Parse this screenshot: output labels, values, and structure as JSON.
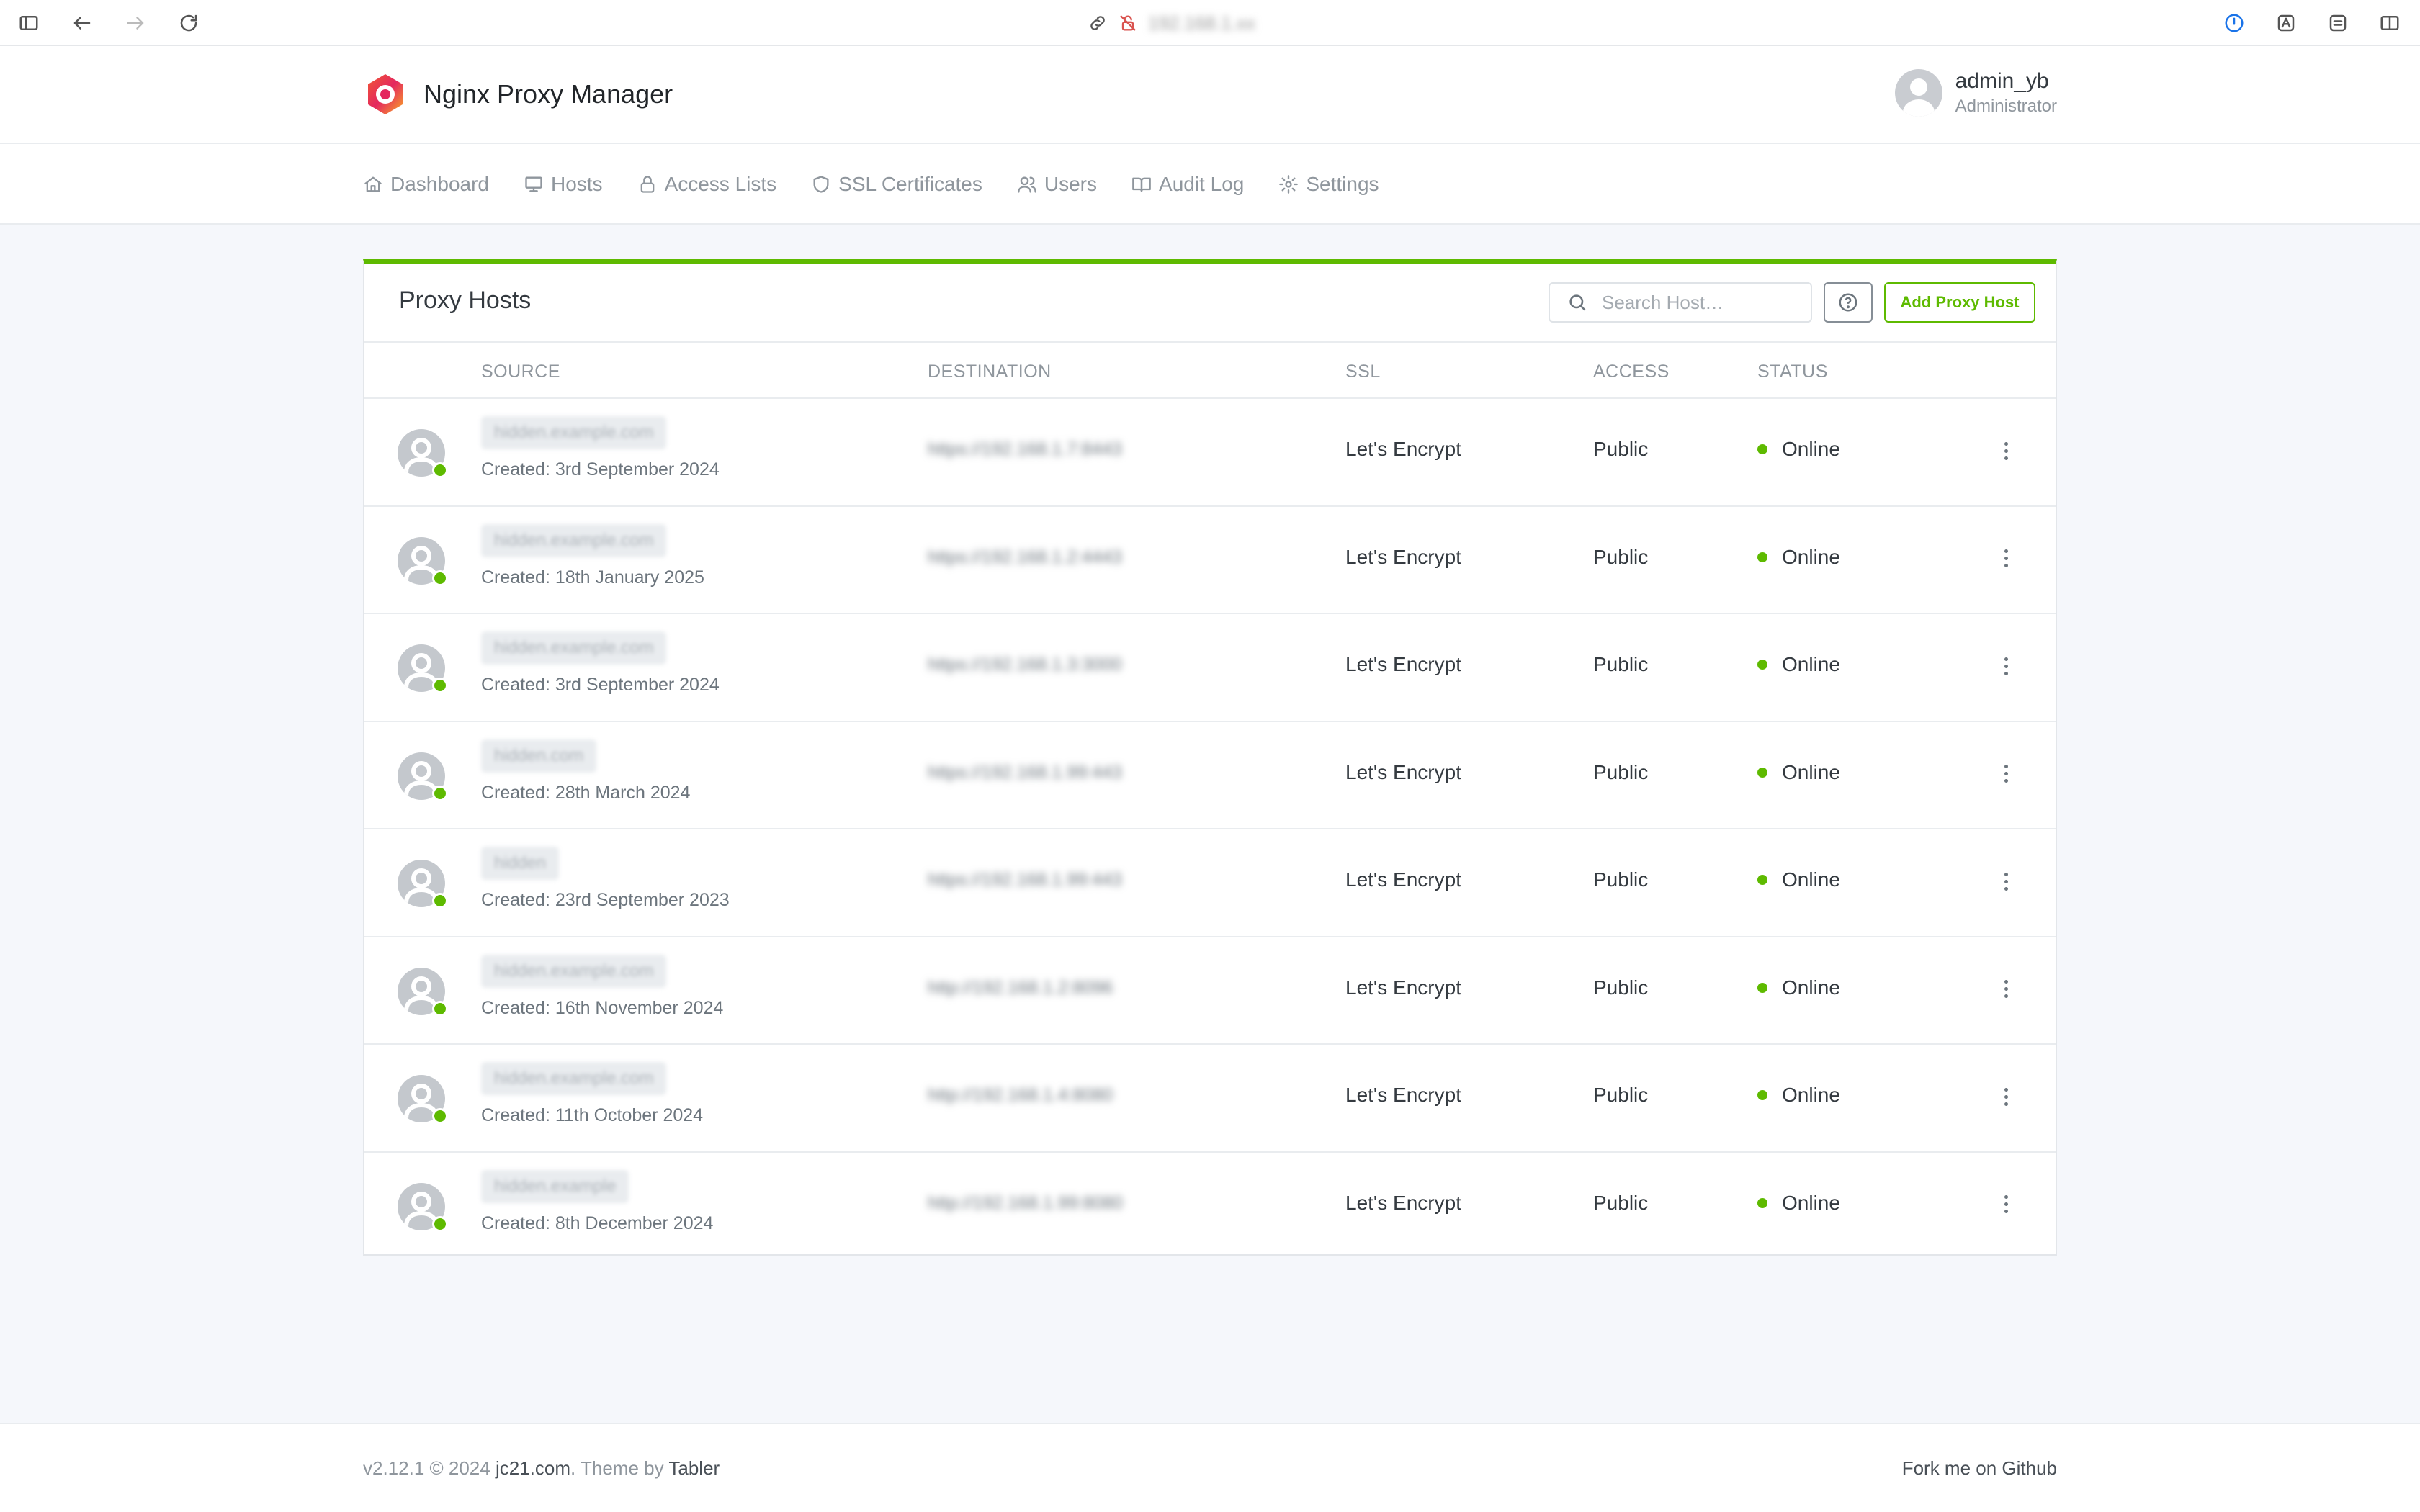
{
  "browser": {
    "url": "192.168.1.xx"
  },
  "app": {
    "title": "Nginx Proxy Manager"
  },
  "user": {
    "name": "admin_yb",
    "role": "Administrator"
  },
  "nav": {
    "items": [
      {
        "label": "Dashboard",
        "icon": "home-icon"
      },
      {
        "label": "Hosts",
        "icon": "monitor-icon"
      },
      {
        "label": "Access Lists",
        "icon": "lock-icon"
      },
      {
        "label": "SSL Certificates",
        "icon": "shield-icon"
      },
      {
        "label": "Users",
        "icon": "users-icon"
      },
      {
        "label": "Audit Log",
        "icon": "book-icon"
      },
      {
        "label": "Settings",
        "icon": "gear-icon"
      }
    ]
  },
  "card": {
    "title": "Proxy Hosts",
    "search_placeholder": "Search Host…",
    "add_button": "Add Proxy Host"
  },
  "table": {
    "headers": {
      "source": "SOURCE",
      "destination": "DESTINATION",
      "ssl": "SSL",
      "access": "ACCESS",
      "status": "STATUS"
    },
    "rows": [
      {
        "source": "hidden.example.com",
        "created": "Created: 3rd September 2024",
        "destination": "https://192.168.1.7:8443",
        "ssl": "Let's Encrypt",
        "access": "Public",
        "status": "Online"
      },
      {
        "source": "hidden.example.com",
        "created": "Created: 18th January 2025",
        "destination": "https://192.168.1.2:4443",
        "ssl": "Let's Encrypt",
        "access": "Public",
        "status": "Online"
      },
      {
        "source": "hidden.example.com",
        "created": "Created: 3rd September 2024",
        "destination": "https://192.168.1.3:3000",
        "ssl": "Let's Encrypt",
        "access": "Public",
        "status": "Online"
      },
      {
        "source": "hidden.com",
        "created": "Created: 28th March 2024",
        "destination": "https://192.168.1.99:443",
        "ssl": "Let's Encrypt",
        "access": "Public",
        "status": "Online"
      },
      {
        "source": "hidden",
        "created": "Created: 23rd September 2023",
        "destination": "https://192.168.1.99:443",
        "ssl": "Let's Encrypt",
        "access": "Public",
        "status": "Online"
      },
      {
        "source": "hidden.example.com",
        "created": "Created: 16th November 2024",
        "destination": "http://192.168.1.2:8096",
        "ssl": "Let's Encrypt",
        "access": "Public",
        "status": "Online"
      },
      {
        "source": "hidden.example.com",
        "created": "Created: 11th October 2024",
        "destination": "http://192.168.1.4:8080",
        "ssl": "Let's Encrypt",
        "access": "Public",
        "status": "Online"
      },
      {
        "source": "hidden.example",
        "created": "Created: 8th December 2024",
        "destination": "http://192.168.1.99:8080",
        "ssl": "Let's Encrypt",
        "access": "Public",
        "status": "Online"
      }
    ]
  },
  "footer": {
    "version": "v2.12.1 © 2024",
    "company_link": "jc21.com",
    "theme_text": ". Theme by",
    "theme_link": "Tabler",
    "github_link": "Fork me on Github"
  },
  "colors": {
    "accent": "#5eba00",
    "text": "#343a40",
    "muted": "#8f969d"
  }
}
